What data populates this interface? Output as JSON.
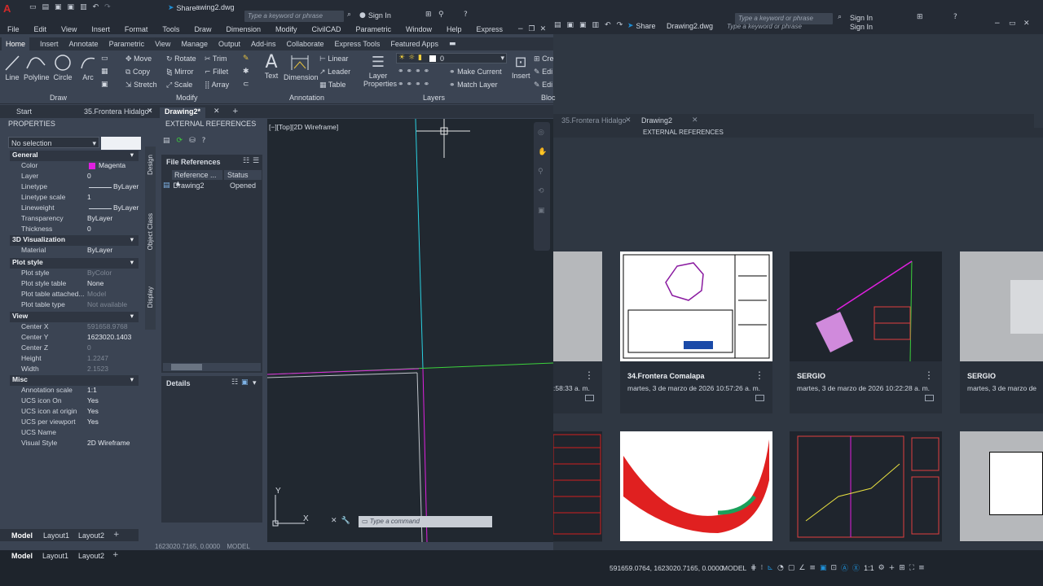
{
  "app": {
    "logo": "A",
    "file_title": "awing2.dwg",
    "file_title_2": "Drawing2.dwg",
    "share_label": "Share",
    "share_label_2": "Share",
    "search_placeholder": "Type a keyword or phrase",
    "search_placeholder_2": "Type a keyword or phrase",
    "search_placeholder_3": "Type a keyword or phrase",
    "signin": "Sign In",
    "signin_2": "Sign In",
    "signin_3": "Sign In"
  },
  "menu": [
    "File",
    "Edit",
    "View",
    "Insert",
    "Format",
    "Tools",
    "Draw",
    "Dimension",
    "Modify",
    "CivilCAD",
    "Parametric",
    "Window",
    "Help",
    "Express"
  ],
  "ribbon_tabs": [
    "Home",
    "Insert",
    "Annotate",
    "Parametric",
    "View",
    "Manage",
    "Output",
    "Add-ins",
    "Collaborate",
    "Express Tools",
    "Featured Apps"
  ],
  "draw_tools": {
    "line": "Line",
    "polyline": "Polyline",
    "circle": "Circle",
    "arc": "Arc",
    "group": "Draw"
  },
  "modify_tools": {
    "move": "Move",
    "rotate": "Rotate",
    "trim": "Trim",
    "copy": "Copy",
    "mirror": "Mirror",
    "fillet": "Fillet",
    "stretch": "Stretch",
    "scale": "Scale",
    "array": "Array",
    "group": "Modify"
  },
  "annotation_tools": {
    "text": "Text",
    "dimension": "Dimension",
    "linear": "Linear",
    "leader": "Leader",
    "table": "Table",
    "group": "Annotation"
  },
  "layer_tools": {
    "layer_properties_1": "Layer",
    "layer_properties_2": "Properties",
    "layer_value": "0",
    "make_current": "Make Current",
    "match_layer": "Match Layer",
    "group": "Layers"
  },
  "insert_tool": {
    "label": "Insert",
    "cre": "Cre",
    "edi1": "Edi",
    "edi2": "Edi",
    "group": "Bloc"
  },
  "doc_tabs": [
    "Start",
    "35.Frontera Hidalgo*",
    "Drawing2*"
  ],
  "doc_tabs_ghost": [
    "35.Frontera Hidalgo",
    "Drawing2"
  ],
  "properties": {
    "title": "PROPERTIES",
    "selection": "No selection",
    "sections": {
      "general": "General",
      "viz3d": "3D Visualization",
      "plot": "Plot style",
      "view": "View",
      "misc": "Misc"
    },
    "general": [
      {
        "k": "Color",
        "v": "Magenta"
      },
      {
        "k": "Layer",
        "v": "0"
      },
      {
        "k": "Linetype",
        "v": "ByLayer"
      },
      {
        "k": "Linetype scale",
        "v": "1"
      },
      {
        "k": "Lineweight",
        "v": "ByLayer"
      },
      {
        "k": "Transparency",
        "v": "ByLayer"
      },
      {
        "k": "Thickness",
        "v": "0"
      }
    ],
    "viz3d": [
      {
        "k": "Material",
        "v": "ByLayer"
      }
    ],
    "plot": [
      {
        "k": "Plot style",
        "v": "ByColor"
      },
      {
        "k": "Plot style table",
        "v": "None"
      },
      {
        "k": "Plot table attached...",
        "v": "Model"
      },
      {
        "k": "Plot table type",
        "v": "Not available"
      }
    ],
    "view": [
      {
        "k": "Center X",
        "v": "591658.9768"
      },
      {
        "k": "Center Y",
        "v": "1623020.1403"
      },
      {
        "k": "Center Z",
        "v": "0"
      },
      {
        "k": "Height",
        "v": "1.2247"
      },
      {
        "k": "Width",
        "v": "2.1523"
      }
    ],
    "misc": [
      {
        "k": "Annotation scale",
        "v": "1:1"
      },
      {
        "k": "UCS icon On",
        "v": "Yes"
      },
      {
        "k": "UCS icon at origin",
        "v": "Yes"
      },
      {
        "k": "UCS per viewport",
        "v": "Yes"
      },
      {
        "k": "UCS Name",
        "v": ""
      },
      {
        "k": "Visual Style",
        "v": "2D Wireframe"
      }
    ],
    "side_tabs": [
      "Design",
      "Object Class",
      "Display"
    ]
  },
  "xref": {
    "title": "EXTERNAL REFERENCES",
    "title_ghost": "EXTERNAL REFERENCES",
    "file_refs": "File References",
    "col_ref": "Reference ...",
    "col_status": "Status",
    "row_name": "Drawing2",
    "row_status": "Opened",
    "details": "Details"
  },
  "viewport": {
    "label": "[−][Top][2D Wireframe]",
    "ucs_x": "X",
    "ucs_y": "Y",
    "command_placeholder": "Type a command"
  },
  "layout_tabs": [
    "Model",
    "Layout1",
    "Layout2"
  ],
  "layout_tabs_2": [
    "Model",
    "Layout1",
    "Layout2"
  ],
  "status": {
    "coords": "591659.0764, 1623020.7165, 0.0000",
    "coords_ghost": "1623020.7165, 0.0000",
    "model": "MODEL",
    "model_ghost": "MODEL",
    "scale": "1:1"
  },
  "recent_files": [
    {
      "name": "",
      "date": ":58:33 a. m."
    },
    {
      "name": "34.Frontera Comalapa",
      "date": "martes, 3 de marzo de 2026 10:57:26 a. m."
    },
    {
      "name": "SERGIO",
      "date": "martes, 3 de marzo de 2026 10:22:28 a. m."
    },
    {
      "name": "SERGIO",
      "date": "martes, 3 de marzo de"
    }
  ],
  "colors": {
    "accent": "#1e8fd6",
    "magenta": "#e020e0",
    "cyan": "#2ad0e0",
    "green": "#3cd23c"
  }
}
